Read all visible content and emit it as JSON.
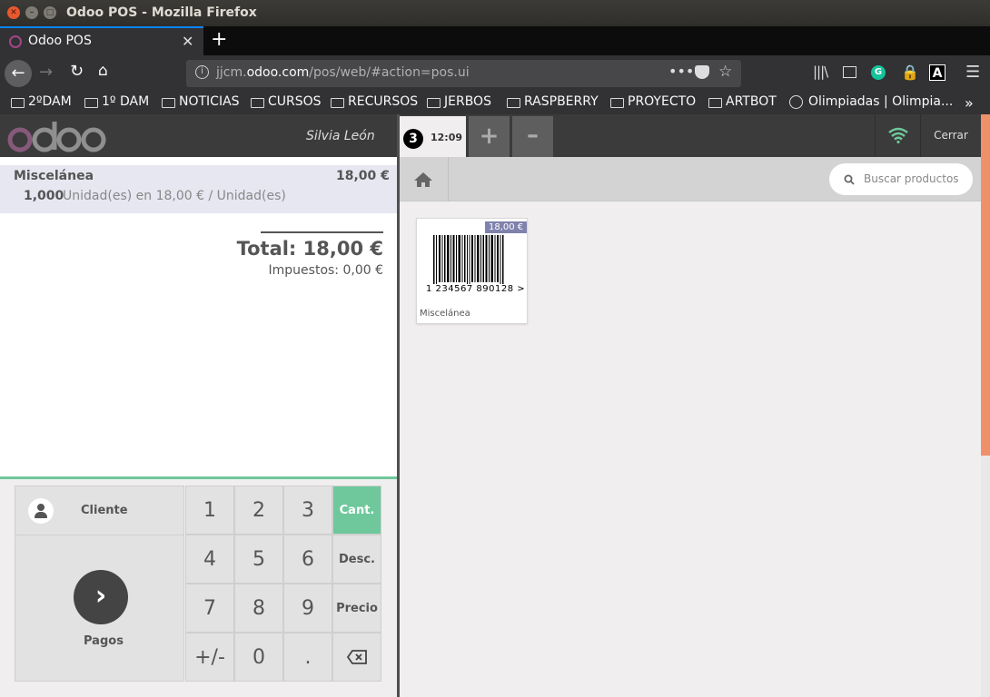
{
  "window": {
    "title": "Odoo POS - Mozilla Firefox"
  },
  "browser": {
    "tab_title": "Odoo POS",
    "url_host": "jjcm.odoo.com",
    "url_prefix": "jjcm.",
    "url_domain": "odoo.com",
    "url_path": "/pos/web/#action=pos.ui",
    "bookmarks": [
      "2ºDAM",
      "1º DAM",
      "NOTICIAS",
      "CURSOS",
      "RECURSOS",
      "JERBOS",
      "RASPBERRY",
      "PROYECTO",
      "ARTBOT",
      "Olimpiadas | Olimpia..."
    ]
  },
  "pos_header": {
    "logo": "odoo",
    "user": "Silvia León",
    "order_number": "3",
    "order_time": "12:09",
    "close_label": "Cerrar"
  },
  "order": {
    "line_name": "Miscelánea",
    "line_price": "18,00 €",
    "line_qty": "1,000",
    "line_detail": "Unidad(es) en 18,00 € / Unidad(es)",
    "total": "Total: 18,00 €",
    "taxes": "Impuestos: 0,00 €"
  },
  "pad": {
    "customer_label": "Cliente",
    "payment_label": "Pagos",
    "keys": [
      "1",
      "2",
      "3",
      "4",
      "5",
      "6",
      "7",
      "8",
      "9",
      "+/-",
      "0",
      "."
    ],
    "modes": [
      "Cant.",
      "Desc.",
      "Precio"
    ]
  },
  "products": {
    "search_placeholder": "Buscar productos",
    "items": [
      {
        "name": "Miscelánea",
        "price": "18,00 €",
        "barcode": "1 234567 890128 >"
      }
    ]
  },
  "colors": {
    "accent": "#6ec89b",
    "odoo_purple": "#875a7b",
    "scroll": "#f0906a",
    "price_tag": "#7f82ac"
  }
}
